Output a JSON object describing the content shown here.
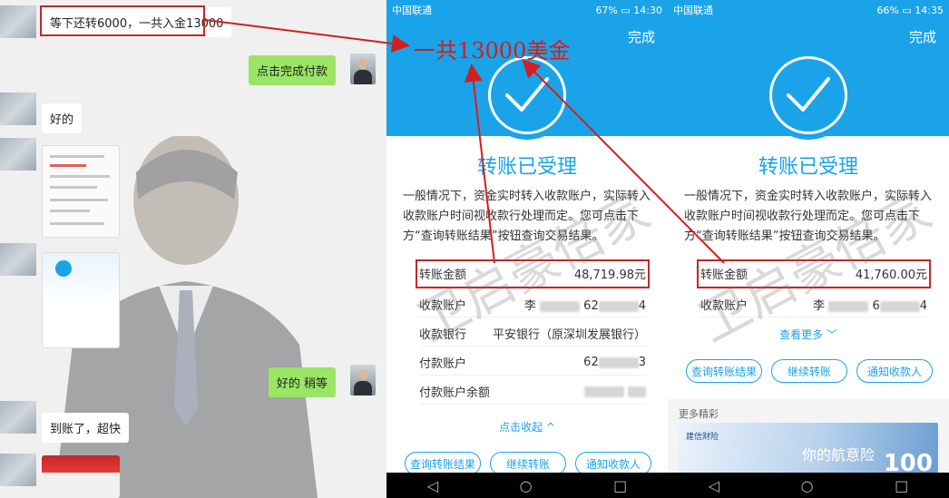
{
  "chat": {
    "messages": [
      {
        "side": "left",
        "text": "等下还转6000，一共入金13000"
      },
      {
        "side": "right",
        "text": "点击完成付款"
      },
      {
        "side": "left",
        "text": "好的"
      },
      {
        "side": "right",
        "text": "好的 稍等"
      },
      {
        "side": "left",
        "text": "到账了，超快"
      }
    ]
  },
  "annotation": {
    "text": "一共13000美金"
  },
  "watermark": {
    "text": "卫启豪倍家"
  },
  "phone1": {
    "status": {
      "carrier": "中国联通",
      "battery": "67%",
      "time": "14:30"
    },
    "done_label": "完成",
    "title": "转账已受理",
    "description": "一般情况下，资金实时转入收款账户，实际转入收款账户时间视收款行处理而定。您可点击下方“查询转账结果”按钮查询交易结果。",
    "rows": [
      {
        "label": "转账金额",
        "value": "48,719.98元"
      },
      {
        "label": "收款账户",
        "value_a": "李",
        "value_b": "62",
        "value_c": "4"
      },
      {
        "label": "收款银行",
        "value": "平安银行（原深圳发展银行）"
      },
      {
        "label": "付款账户",
        "value_a": "62",
        "value_c": "3"
      },
      {
        "label": "付款账户余额",
        "value": ""
      }
    ],
    "collapse_label": "点击收起 ^",
    "buttons": [
      "查询转账结果",
      "继续转账",
      "通知收款人"
    ]
  },
  "phone2": {
    "status": {
      "carrier": "中国联通",
      "battery": "66%",
      "time": "14:35"
    },
    "done_label": "完成",
    "title": "转账已受理",
    "description": "一般情况下，资金实时转入收款账户，实际转入收款账户时间视收款行处理而定。您可点击下方“查询转账结果”按钮查询交易结果。",
    "rows": [
      {
        "label": "转账金额",
        "value": "41,760.00元"
      },
      {
        "label": "收款账户",
        "value_a": "李",
        "value_b": "6",
        "value_c": "4"
      }
    ],
    "more_label": "查看更多 ﹀",
    "buttons": [
      "查询转账结果",
      "继续转账",
      "通知收款人"
    ],
    "more_section": {
      "header": "更多精彩",
      "banner_logo": "建信财险",
      "banner_slogan": "你的航意险",
      "banner_number": "100"
    }
  },
  "colors": {
    "primary_blue": "#1aa3e8",
    "annotation_red": "#d11f1f",
    "chat_green": "#9be565"
  },
  "icons": {
    "check": "check-circle-icon",
    "back": "back-triangle-icon",
    "home": "home-circle-icon",
    "recent": "recent-square-icon"
  }
}
